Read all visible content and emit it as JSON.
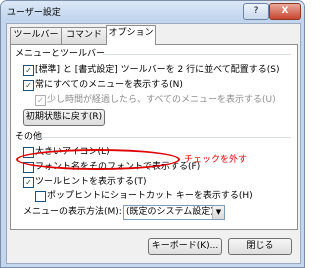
{
  "window": {
    "title": "ユーザー設定",
    "help_label": "?",
    "close_label": "X"
  },
  "tabs": [
    {
      "label": "ツールバー"
    },
    {
      "label": "コマンド"
    },
    {
      "label": "オプション",
      "active": true
    }
  ],
  "options": {
    "section_menus": "メニューとツールバー",
    "standard_format_two_rows": {
      "label": "[標準] と [書式設定] ツールバーを 2 行に並べて配置する(S)",
      "checked": true
    },
    "always_full_menus": {
      "label": "常にすべてのメニューを表示する(N)",
      "checked": true
    },
    "show_full_after_delay": {
      "label": "少し時間が経過したら、すべてのメニューを表示する(U)",
      "checked": true,
      "disabled": true
    },
    "reset_button": "初期状態に戻す(R)",
    "section_other": "その他",
    "large_icons": {
      "label": "大きいアイコン(L)",
      "checked": false
    },
    "font_names_in_font": {
      "label": "フォント名をそのフォントで表示する(F)",
      "checked": false
    },
    "show_screentips": {
      "label": "ツールヒントを表示する(T)",
      "checked": true
    },
    "shortcut_keys_in_tips": {
      "label": "ポップヒントにショートカット キーを表示する(H)",
      "checked": false
    },
    "menu_animation_label": "メニューの表示方法(M):",
    "menu_animation_value": "(既定のシステム設定)"
  },
  "annotation": {
    "text": "チェックを外す",
    "color": "#e00000"
  },
  "footer": {
    "keyboard_button": "キーボード(K)...",
    "close_button": "閉じる"
  }
}
